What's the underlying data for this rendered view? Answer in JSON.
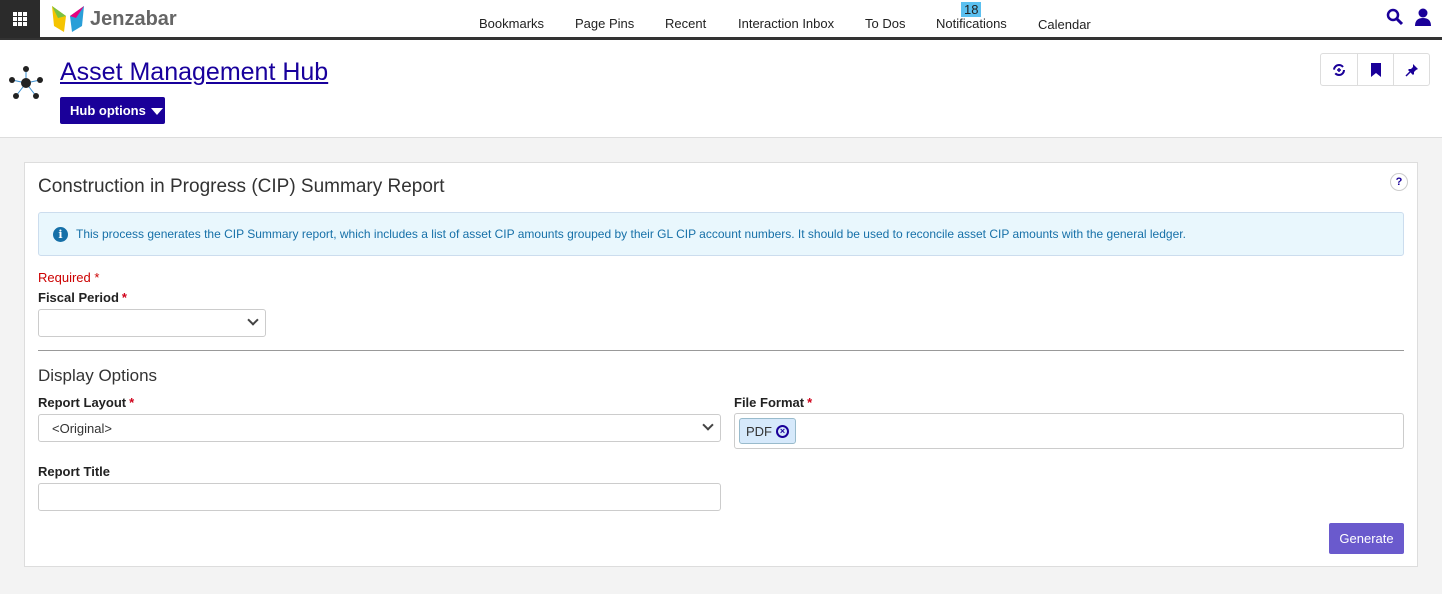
{
  "topbar": {
    "brand": "Jenzabar",
    "nav": [
      "Bookmarks",
      "Page Pins",
      "Recent",
      "Interaction Inbox",
      "To Dos",
      "Notifications",
      "Calendar"
    ],
    "notifications_count": "18"
  },
  "header": {
    "title": "Asset Management Hub",
    "hub_options": "Hub options"
  },
  "card": {
    "title": "Construction in Progress (CIP) Summary Report",
    "help": "?",
    "info": "This process generates the CIP Summary report, which includes a list of asset CIP amounts grouped by their GL CIP account numbers. It should be used to reconcile asset CIP amounts with the general ledger.",
    "required": "Required",
    "star": "*",
    "fiscal_period_label": "Fiscal Period",
    "fiscal_period_value": "",
    "display_options": "Display Options",
    "report_layout_label": "Report Layout",
    "report_layout_value": "<Original>",
    "file_format_label": "File Format",
    "file_format_chip": "PDF",
    "report_title_label": "Report Title",
    "report_title_value": "",
    "generate": "Generate"
  },
  "colors": {
    "accent": "#1a0099",
    "generate": "#6a5acd",
    "info_bg": "#e9f7fd",
    "badge": "#5bc0f0"
  }
}
